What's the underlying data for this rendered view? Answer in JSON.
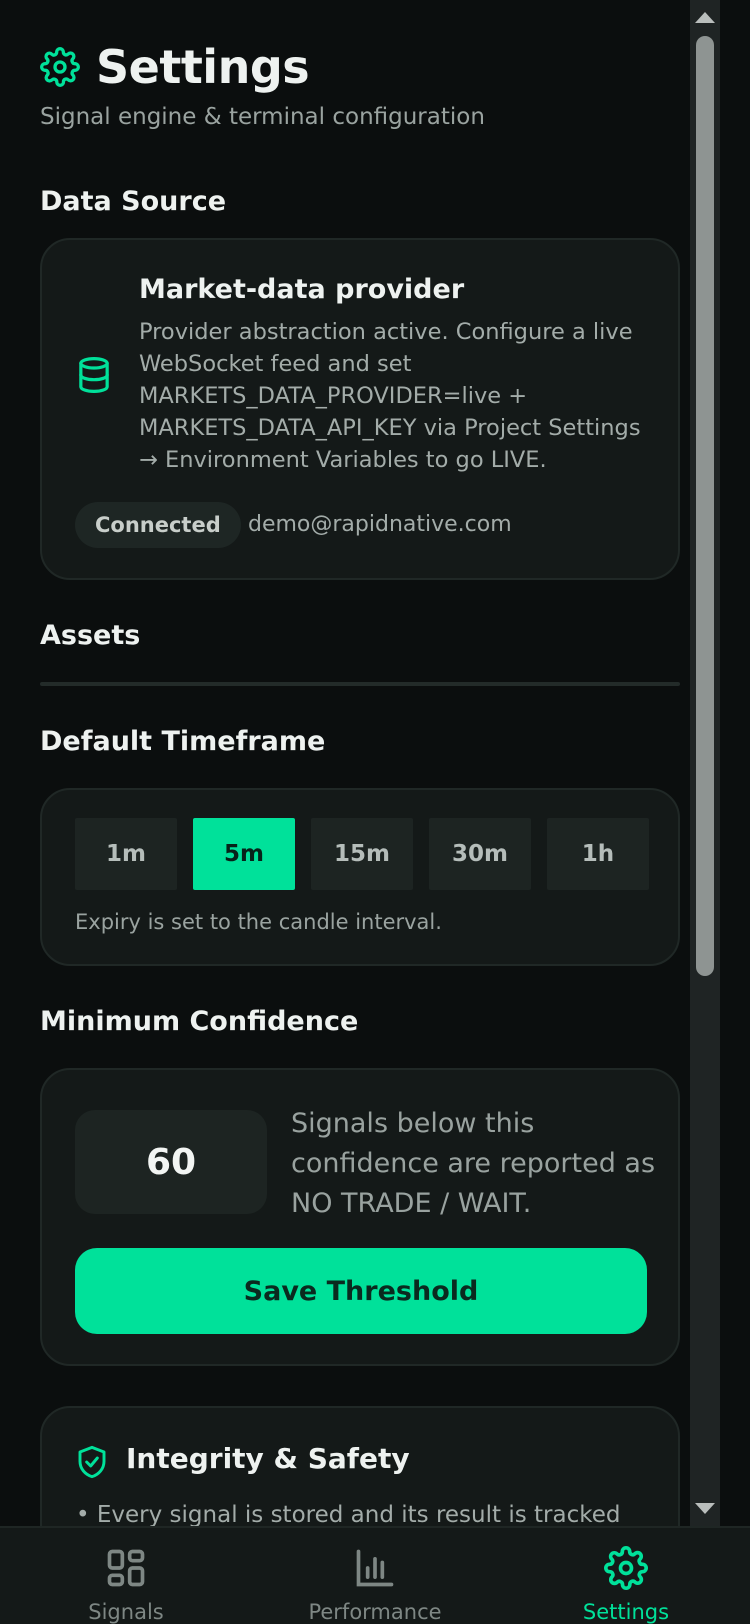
{
  "header": {
    "title": "Settings",
    "subtitle": "Signal engine & terminal configuration"
  },
  "data_source": {
    "section_title": "Data Source",
    "heading": "Market-data provider",
    "body": "Provider abstraction active. Configure a live\nWebSocket feed and set\nMARKETS_DATA_PROVIDER=live +\nMARKETS_DATA_API_KEY via Project Settings\n→ Environment Variables to go LIVE.",
    "status": "Connected",
    "email": "demo@rapidnative.com",
    "icon": "database-icon"
  },
  "assets": {
    "section_title": "Assets"
  },
  "timeframe": {
    "section_title": "Default Timeframe",
    "options": [
      "1m",
      "5m",
      "15m",
      "30m",
      "1h"
    ],
    "selected": "5m",
    "note": "Expiry is set to the candle interval."
  },
  "confidence": {
    "section_title": "Minimum Confidence",
    "value": "60",
    "description": "Signals below this confidence are reported as NO TRADE / WAIT.",
    "save_label": "Save Threshold"
  },
  "integrity": {
    "heading": "Integrity & Safety",
    "bullet": "• Every signal is stored and its result is tracked",
    "icon": "shield-check-icon"
  },
  "tabs": [
    {
      "label": "Signals",
      "icon": "grid-icon"
    },
    {
      "label": "Performance",
      "icon": "bar-chart-icon"
    },
    {
      "label": "Settings",
      "icon": "gear-icon",
      "active": true
    }
  ],
  "colors": {
    "accent": "#00e19a",
    "background": "#0b0e0e",
    "card": "#141918"
  }
}
